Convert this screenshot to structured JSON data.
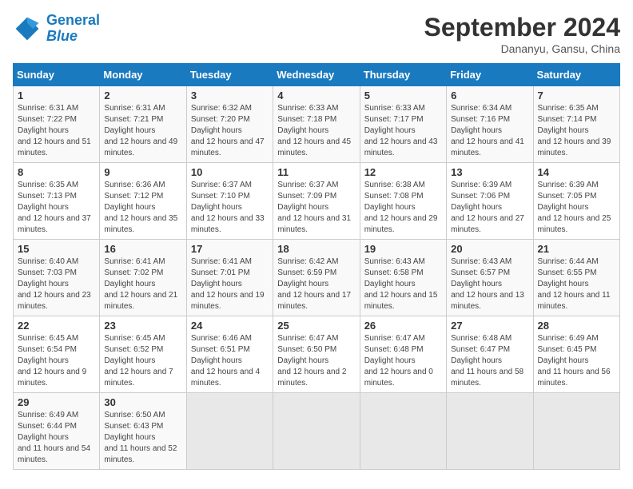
{
  "header": {
    "logo_line1": "General",
    "logo_line2": "Blue",
    "month": "September 2024",
    "location": "Dananyu, Gansu, China"
  },
  "weekdays": [
    "Sunday",
    "Monday",
    "Tuesday",
    "Wednesday",
    "Thursday",
    "Friday",
    "Saturday"
  ],
  "weeks": [
    [
      {
        "day": 1,
        "sunrise": "6:31 AM",
        "sunset": "7:22 PM",
        "daylight": "12 hours and 51 minutes."
      },
      {
        "day": 2,
        "sunrise": "6:31 AM",
        "sunset": "7:21 PM",
        "daylight": "12 hours and 49 minutes."
      },
      {
        "day": 3,
        "sunrise": "6:32 AM",
        "sunset": "7:20 PM",
        "daylight": "12 hours and 47 minutes."
      },
      {
        "day": 4,
        "sunrise": "6:33 AM",
        "sunset": "7:18 PM",
        "daylight": "12 hours and 45 minutes."
      },
      {
        "day": 5,
        "sunrise": "6:33 AM",
        "sunset": "7:17 PM",
        "daylight": "12 hours and 43 minutes."
      },
      {
        "day": 6,
        "sunrise": "6:34 AM",
        "sunset": "7:16 PM",
        "daylight": "12 hours and 41 minutes."
      },
      {
        "day": 7,
        "sunrise": "6:35 AM",
        "sunset": "7:14 PM",
        "daylight": "12 hours and 39 minutes."
      }
    ],
    [
      {
        "day": 8,
        "sunrise": "6:35 AM",
        "sunset": "7:13 PM",
        "daylight": "12 hours and 37 minutes."
      },
      {
        "day": 9,
        "sunrise": "6:36 AM",
        "sunset": "7:12 PM",
        "daylight": "12 hours and 35 minutes."
      },
      {
        "day": 10,
        "sunrise": "6:37 AM",
        "sunset": "7:10 PM",
        "daylight": "12 hours and 33 minutes."
      },
      {
        "day": 11,
        "sunrise": "6:37 AM",
        "sunset": "7:09 PM",
        "daylight": "12 hours and 31 minutes."
      },
      {
        "day": 12,
        "sunrise": "6:38 AM",
        "sunset": "7:08 PM",
        "daylight": "12 hours and 29 minutes."
      },
      {
        "day": 13,
        "sunrise": "6:39 AM",
        "sunset": "7:06 PM",
        "daylight": "12 hours and 27 minutes."
      },
      {
        "day": 14,
        "sunrise": "6:39 AM",
        "sunset": "7:05 PM",
        "daylight": "12 hours and 25 minutes."
      }
    ],
    [
      {
        "day": 15,
        "sunrise": "6:40 AM",
        "sunset": "7:03 PM",
        "daylight": "12 hours and 23 minutes."
      },
      {
        "day": 16,
        "sunrise": "6:41 AM",
        "sunset": "7:02 PM",
        "daylight": "12 hours and 21 minutes."
      },
      {
        "day": 17,
        "sunrise": "6:41 AM",
        "sunset": "7:01 PM",
        "daylight": "12 hours and 19 minutes."
      },
      {
        "day": 18,
        "sunrise": "6:42 AM",
        "sunset": "6:59 PM",
        "daylight": "12 hours and 17 minutes."
      },
      {
        "day": 19,
        "sunrise": "6:43 AM",
        "sunset": "6:58 PM",
        "daylight": "12 hours and 15 minutes."
      },
      {
        "day": 20,
        "sunrise": "6:43 AM",
        "sunset": "6:57 PM",
        "daylight": "12 hours and 13 minutes."
      },
      {
        "day": 21,
        "sunrise": "6:44 AM",
        "sunset": "6:55 PM",
        "daylight": "12 hours and 11 minutes."
      }
    ],
    [
      {
        "day": 22,
        "sunrise": "6:45 AM",
        "sunset": "6:54 PM",
        "daylight": "12 hours and 9 minutes."
      },
      {
        "day": 23,
        "sunrise": "6:45 AM",
        "sunset": "6:52 PM",
        "daylight": "12 hours and 7 minutes."
      },
      {
        "day": 24,
        "sunrise": "6:46 AM",
        "sunset": "6:51 PM",
        "daylight": "12 hours and 4 minutes."
      },
      {
        "day": 25,
        "sunrise": "6:47 AM",
        "sunset": "6:50 PM",
        "daylight": "12 hours and 2 minutes."
      },
      {
        "day": 26,
        "sunrise": "6:47 AM",
        "sunset": "6:48 PM",
        "daylight": "12 hours and 0 minutes."
      },
      {
        "day": 27,
        "sunrise": "6:48 AM",
        "sunset": "6:47 PM",
        "daylight": "11 hours and 58 minutes."
      },
      {
        "day": 28,
        "sunrise": "6:49 AM",
        "sunset": "6:45 PM",
        "daylight": "11 hours and 56 minutes."
      }
    ],
    [
      {
        "day": 29,
        "sunrise": "6:49 AM",
        "sunset": "6:44 PM",
        "daylight": "11 hours and 54 minutes."
      },
      {
        "day": 30,
        "sunrise": "6:50 AM",
        "sunset": "6:43 PM",
        "daylight": "11 hours and 52 minutes."
      },
      null,
      null,
      null,
      null,
      null
    ]
  ]
}
